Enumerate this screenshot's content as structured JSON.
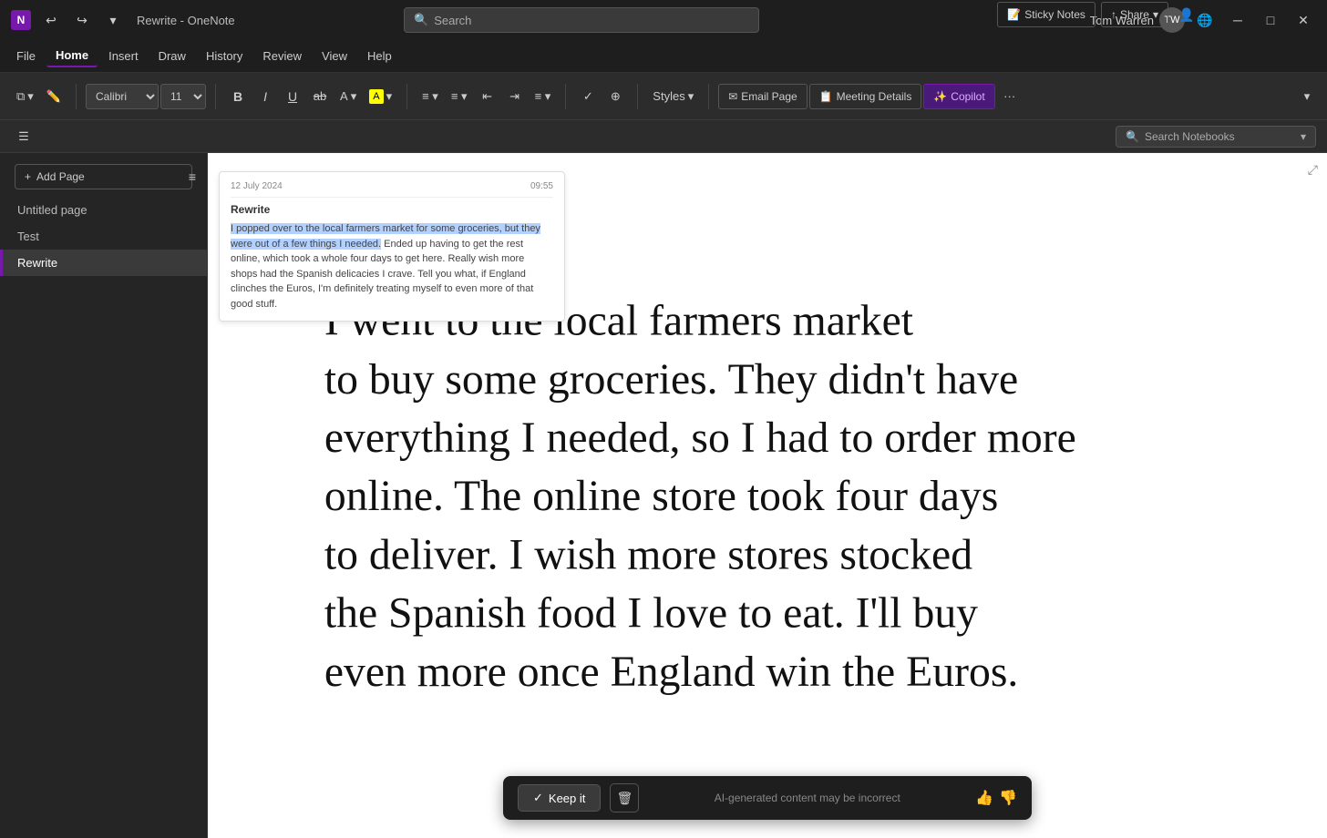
{
  "app": {
    "logo": "N",
    "title": "Rewrite - OneNote"
  },
  "titlebar": {
    "undo_label": "↩",
    "redo_label": "↪",
    "dropdown_label": "▾",
    "search_placeholder": "Search",
    "user_name": "Tom Warren",
    "minimize_label": "─",
    "maximize_label": "□",
    "close_label": "✕"
  },
  "menubar": {
    "items": [
      {
        "id": "file",
        "label": "File"
      },
      {
        "id": "home",
        "label": "Home",
        "active": true
      },
      {
        "id": "insert",
        "label": "Insert"
      },
      {
        "id": "draw",
        "label": "Draw"
      },
      {
        "id": "history",
        "label": "History"
      },
      {
        "id": "review",
        "label": "Review"
      },
      {
        "id": "view",
        "label": "View"
      },
      {
        "id": "help",
        "label": "Help"
      }
    ]
  },
  "toolbar": {
    "clipboard_icon": "⧉",
    "paste_label": "",
    "font_name": "Calibri",
    "font_size": "11",
    "bold_label": "B",
    "italic_label": "I",
    "underline_label": "U",
    "strikethrough_label": "ab",
    "font_color_label": "A",
    "highlight_label": "A",
    "bullet_label": "≡",
    "numbered_label": "≡",
    "outdent_label": "⇤",
    "indent_label": "⇥",
    "align_label": "≡",
    "check_label": "✓",
    "zoom_label": "⊕",
    "styles_label": "Styles",
    "email_page_label": "Email Page",
    "meeting_details_label": "Meeting Details",
    "copilot_label": "Copilot",
    "more_label": "···",
    "sticky_notes_label": "Sticky Notes",
    "share_label": "Share"
  },
  "secondary_toolbar": {
    "hamburger": "☰",
    "search_notebooks_placeholder": "Search Notebooks"
  },
  "sidebar": {
    "add_page_label": "Add Page",
    "sort_icon": "≡",
    "pages": [
      {
        "id": "untitled",
        "label": "Untitled page",
        "active": false
      },
      {
        "id": "test",
        "label": "Test",
        "active": false
      },
      {
        "id": "rewrite",
        "label": "Rewrite",
        "active": true
      }
    ]
  },
  "rewrite_card": {
    "date": "12 July 2024",
    "time": "09:55",
    "title": "Rewrite",
    "text": "I popped over to the local farmers market for some groceries, but they were out of a few things I needed. Ended up having to get the rest online, which took a whole four days to get here. Really wish more shops had the Spanish delicacies I crave. Tell you what, if England clinches the Euros, I'm definitely treating myself to even more of that good stuff."
  },
  "handwriting": {
    "lines": [
      "I went to the local farmers market",
      "to buy some groceries. They didn't have",
      "everything I needed, so I had to order more",
      "online. The online store took four days",
      "to deliver. I wish more stores stocked",
      "the Spanish food I love to eat. I'll buy",
      "even more once England win the Euros."
    ]
  },
  "action_bar": {
    "keep_label": "Keep it",
    "check_icon": "✓",
    "discard_icon": "🗑",
    "ai_notice": "AI-generated content may be incorrect",
    "thumbs_up": "👍",
    "thumbs_down": "👎"
  },
  "expand_btn": "⤢"
}
